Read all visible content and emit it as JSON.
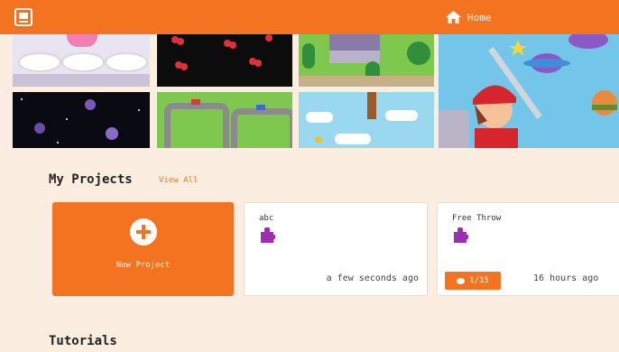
{
  "nav": {
    "home_label": "Home"
  },
  "my_projects": {
    "title": "My Projects",
    "view_all": "View All",
    "new_project_label": "New Project",
    "projects": [
      {
        "name": "abc",
        "time": "a few seconds ago"
      },
      {
        "name": "Free Throw",
        "time": "16 hours ago",
        "badge": "1/15"
      }
    ]
  },
  "tutorials": {
    "title": "Tutorials"
  },
  "colors": {
    "accent": "#f47320",
    "background": "#fbeee0"
  },
  "icons": [
    "app-logo-icon",
    "home-icon",
    "plus-icon",
    "puzzle-icon",
    "comment-icon"
  ]
}
